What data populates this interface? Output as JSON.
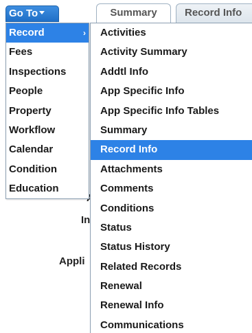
{
  "goto_button": {
    "label": "Go To"
  },
  "tabs": [
    {
      "label": "Summary"
    },
    {
      "label": "Record Info"
    }
  ],
  "background_labels": [
    {
      "label": "In"
    },
    {
      "label": "Appli"
    },
    {
      "label": "A"
    }
  ],
  "left_menu": {
    "items": [
      {
        "label": "Record",
        "active": true
      },
      {
        "label": "Fees"
      },
      {
        "label": "Inspections"
      },
      {
        "label": "People"
      },
      {
        "label": "Property"
      },
      {
        "label": "Workflow"
      },
      {
        "label": "Calendar"
      },
      {
        "label": "Condition"
      },
      {
        "label": "Education"
      }
    ],
    "active_chevron": "›"
  },
  "sub_menu": {
    "items": [
      {
        "label": "Activities"
      },
      {
        "label": "Activity Summary"
      },
      {
        "label": "Addtl Info"
      },
      {
        "label": "App Specific Info"
      },
      {
        "label": "App Specific Info Tables"
      },
      {
        "label": "Summary"
      },
      {
        "label": "Record Info",
        "active": true
      },
      {
        "label": "Attachments"
      },
      {
        "label": "Comments"
      },
      {
        "label": "Conditions"
      },
      {
        "label": "Status"
      },
      {
        "label": "Status History"
      },
      {
        "label": "Related Records"
      },
      {
        "label": "Renewal"
      },
      {
        "label": "Renewal Info"
      },
      {
        "label": "Communications"
      }
    ]
  },
  "colors": {
    "highlight": "#2d82e6",
    "button": "#1f6fc7"
  }
}
